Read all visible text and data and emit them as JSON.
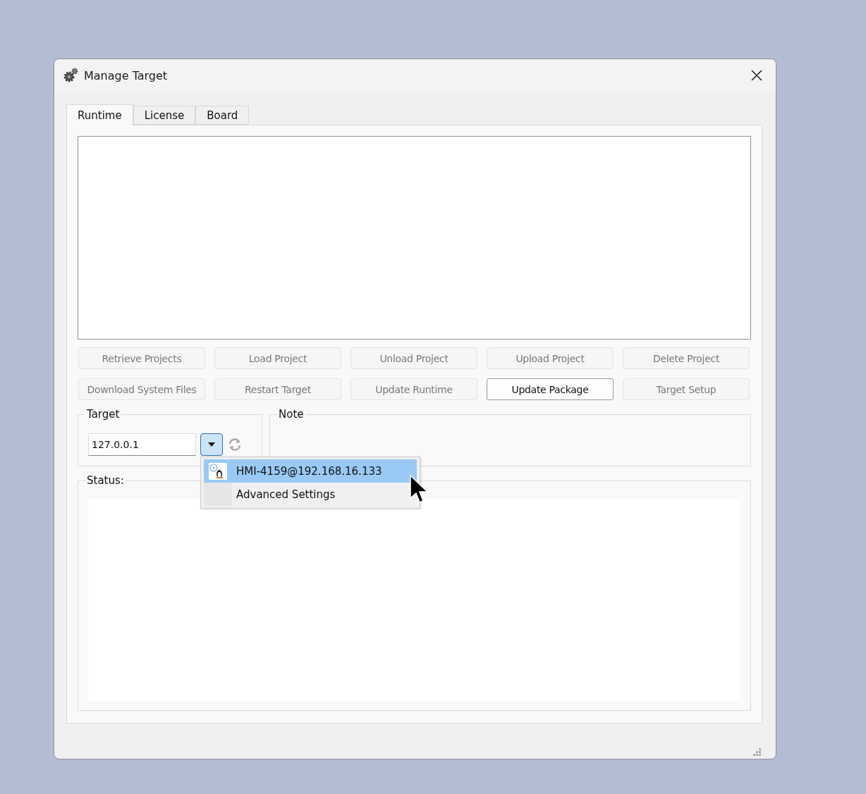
{
  "window": {
    "title": "Manage Target"
  },
  "tabs": [
    {
      "label": "Runtime",
      "selected": true
    },
    {
      "label": "License",
      "selected": false
    },
    {
      "label": "Board",
      "selected": false
    }
  ],
  "buttons": [
    {
      "label": "Retrieve Projects",
      "disabled": true
    },
    {
      "label": "Load Project",
      "disabled": true
    },
    {
      "label": "Unload Project",
      "disabled": true
    },
    {
      "label": "Upload Project",
      "disabled": true
    },
    {
      "label": "Delete Project",
      "disabled": true
    },
    {
      "label": "Download System Files",
      "disabled": true
    },
    {
      "label": "Restart Target",
      "disabled": true
    },
    {
      "label": "Update Runtime",
      "disabled": true
    },
    {
      "label": "Update Package",
      "disabled": false
    },
    {
      "label": "Target Setup",
      "disabled": true
    }
  ],
  "target": {
    "label": "Target",
    "value": "127.0.0.1"
  },
  "note": {
    "label": "Note"
  },
  "status": {
    "label": "Status:"
  },
  "dropdown_menu": [
    {
      "label": "HMI-4159@192.168.16.133",
      "selected": true,
      "kind": "device"
    },
    {
      "label": "Advanced Settings",
      "selected": false,
      "kind": "plain"
    }
  ]
}
